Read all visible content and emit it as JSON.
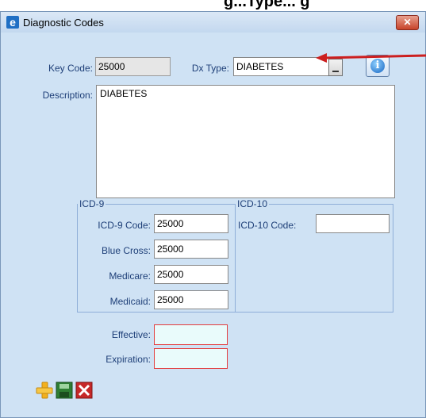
{
  "caption": "g...Type... g",
  "window": {
    "title": "Diagnostic Codes",
    "close_label": "✕"
  },
  "form": {
    "key_code_label": "Key Code:",
    "key_code_value": "25000",
    "dx_type_label": "Dx Type:",
    "dx_type_value": "DIABETES",
    "description_label": "Description:",
    "description_value": "DIABETES"
  },
  "icd9": {
    "legend": "ICD-9",
    "code_label": "ICD-9 Code:",
    "code_value": "25000",
    "blue_cross_label": "Blue Cross:",
    "blue_cross_value": "25000",
    "medicare_label": "Medicare:",
    "medicare_value": "25000",
    "medicaid_label": "Medicaid:",
    "medicaid_value": "25000"
  },
  "icd10": {
    "legend": "ICD-10",
    "code_label": "ICD-10 Code:",
    "code_value": ""
  },
  "dates": {
    "effective_label": "Effective:",
    "effective_value": "",
    "expiration_label": "Expiration:",
    "expiration_value": ""
  },
  "toolbar": {
    "add_icon": "plus-icon",
    "save_icon": "save-icon",
    "delete_icon": "delete-x-icon"
  },
  "colors": {
    "annotation_arrow": "#cc1f1f",
    "required_border": "#e43b3b",
    "window_bg": "#cfe2f4"
  }
}
